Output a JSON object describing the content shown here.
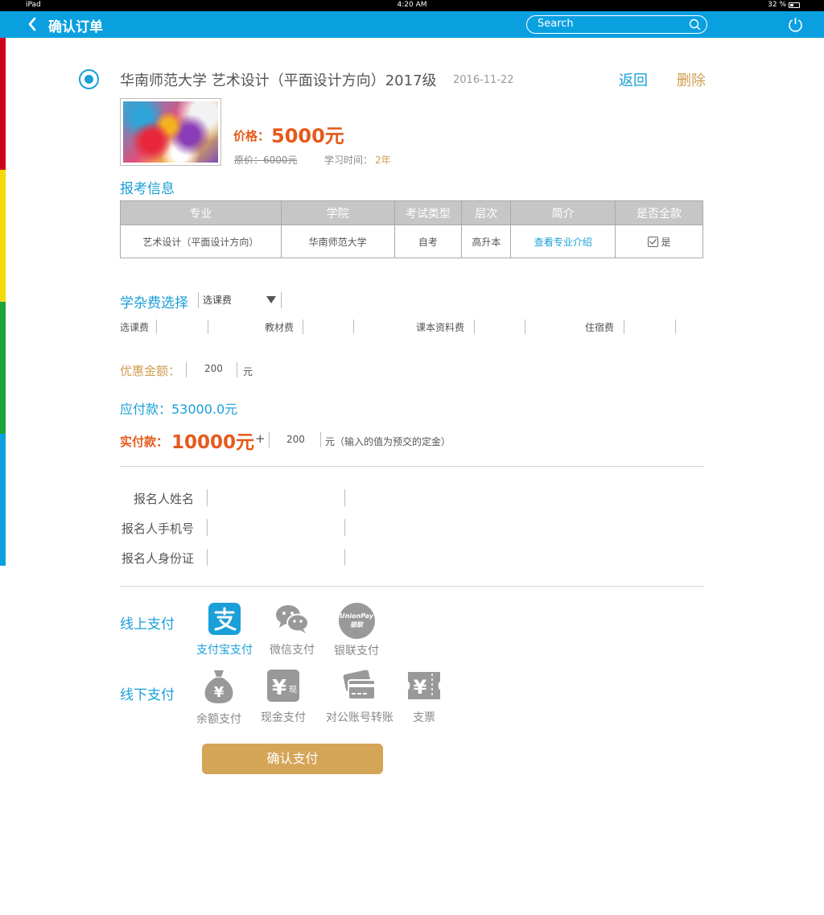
{
  "status_bar": {
    "device": "iPad",
    "time": "4:20 AM",
    "battery": "32 %"
  },
  "nav": {
    "title": "确认订单",
    "search_placeholder": "Search"
  },
  "stripe_colors": [
    "#d0021b",
    "#f5d90a",
    "#1fa23a",
    "#0aa0e0"
  ],
  "order": {
    "title": "华南师范大学  艺术设计（平面设计方向）2017级",
    "date": "2016-11-22",
    "back_label": "返回",
    "delete_label": "删除",
    "price_label": "价格：",
    "price_value": "5000元",
    "original_price": "原价：6000元",
    "study_time_label": "学习时间：",
    "study_time_value": "2年"
  },
  "registration": {
    "section_title": "报考信息",
    "columns": [
      "专业",
      "学院",
      "考试类型",
      "层次",
      "简介",
      "是否全款"
    ],
    "row": {
      "major": "艺术设计（平面设计方向）",
      "college": "华南师范大学",
      "exam_type": "自考",
      "level": "高升本",
      "intro_link": "查看专业介绍",
      "full_payment": "是"
    }
  },
  "fees": {
    "section_title": "学杂费选择",
    "selected": "选课费",
    "items": [
      "选课费",
      "教材费",
      "课本资料费",
      "住宿费"
    ]
  },
  "discount": {
    "label": "优惠金额：",
    "value": "200",
    "unit": "元"
  },
  "payable": {
    "text": "应付款：53000.0元"
  },
  "actual": {
    "label": "实付款：",
    "value": "10000元",
    "plus": "+",
    "deposit": "200",
    "note": "元（输入的值为预交的定金）"
  },
  "applicant": {
    "name_label": "报名人姓名",
    "phone_label": "报名人手机号",
    "id_label": "报名人身份证"
  },
  "online_payment": {
    "title": "线上支付",
    "methods": [
      "支付宝支付",
      "微信支付",
      "银联支付"
    ],
    "unionpay_logo_text": "UnionPay 银联"
  },
  "offline_payment": {
    "title": "线下支付",
    "methods": [
      "余额支付",
      "现金支付",
      "对公账号转账",
      "支票"
    ]
  },
  "confirm_button": "确认支付"
}
